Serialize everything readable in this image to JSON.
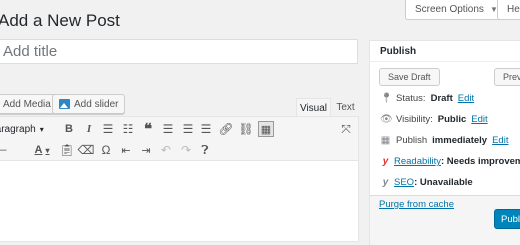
{
  "header": {
    "page_title": "Add a New Post",
    "screen_options_label": "Screen Options",
    "help_label": "Help"
  },
  "editor": {
    "title_placeholder": "Add title",
    "add_media_label": "Add Media",
    "add_slider_label": "Add slider",
    "tab_visual": "Visual",
    "tab_text": "Text",
    "format_select_value": "Paragraph",
    "toolbar_row1": [
      "bold-icon",
      "italic-icon",
      "bulleted-list-icon",
      "numbered-list-icon",
      "blockquote-icon",
      "align-left-icon",
      "align-center-icon",
      "align-right-icon",
      "link-icon",
      "unlink-icon",
      "toolbar-toggle-icon",
      "fullscreen-icon"
    ],
    "toolbar_row2": [
      "horizontal-line-icon",
      "text-color-icon",
      "paste-text-icon",
      "clear-formatting-icon",
      "special-character-icon",
      "outdent-icon",
      "indent-icon",
      "undo-icon",
      "redo-icon",
      "help-icon"
    ]
  },
  "publish": {
    "heading": "Publish",
    "save_draft_label": "Save Draft",
    "preview_label": "Preview",
    "status_label": "Status:",
    "status_value": "Draft",
    "visibility_label": "Visibility:",
    "visibility_value": "Public",
    "publish_prefix": "Publish",
    "publish_when": "immediately",
    "edit_link": "Edit",
    "readability_link": "Readability",
    "readability_value": ": Needs improvement",
    "seo_link": "SEO",
    "seo_value": ": Unavailable",
    "purge_cache_label": "Purge from cache",
    "publish_button_label": "Publish",
    "readability_status_color": "#dc3232"
  }
}
